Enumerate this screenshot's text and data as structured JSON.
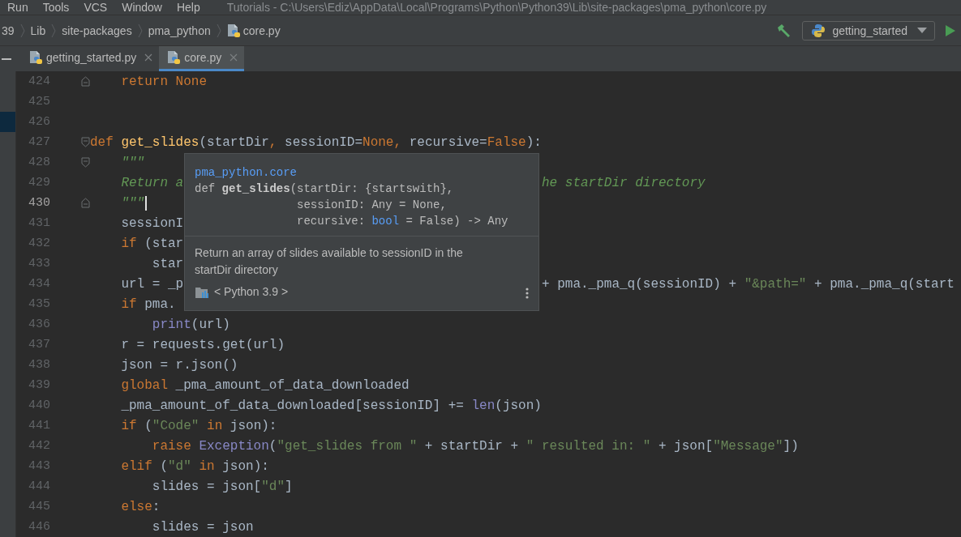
{
  "menu": [
    {
      "label": "Run"
    },
    {
      "label": "Tools"
    },
    {
      "label": "VCS"
    },
    {
      "label": "Window"
    },
    {
      "label": "Help"
    }
  ],
  "window_title": "Tutorials - C:\\Users\\Ediz\\AppData\\Local\\Programs\\Python\\Python39\\Lib\\site-packages\\pma_python\\core.py",
  "breadcrumbs": [
    {
      "label": "39",
      "kind": "folder"
    },
    {
      "label": "Lib",
      "kind": "folder"
    },
    {
      "label": "site-packages",
      "kind": "folder"
    },
    {
      "label": "pma_python",
      "kind": "folder"
    },
    {
      "label": "core.py",
      "kind": "file"
    }
  ],
  "run_config": {
    "label": "getting_started"
  },
  "tabs": [
    {
      "label": "getting_started.py",
      "selected": false
    },
    {
      "label": "core.py",
      "selected": true
    }
  ],
  "code": [
    {
      "kind": "context",
      "children": [
        {
          "number": "424",
          "fold": {
            "kind": "end"
          },
          "tokens": [
            {
              "text": "return None",
              "kind": "kw"
            }
          ]
        }
      ]
    },
    {
      "kind": "line",
      "number": "425"
    },
    {
      "kind": "line",
      "number": "426"
    },
    {
      "kind": "line",
      "number": "427",
      "fold": {
        "kind": "start"
      },
      "tokens": [
        {
          "text": "def ",
          "kind": "kw"
        },
        {
          "text": "get_slides",
          "kind": "fn"
        },
        {
          "text": "(startDir",
          "kind": "plain"
        },
        {
          "text": ", ",
          "kind": "kw"
        },
        {
          "text": "sessionID=",
          "kind": "plain"
        },
        {
          "text": "None",
          "kind": "kw"
        },
        {
          "text": ", ",
          "kind": "kw"
        },
        {
          "text": "recursive=",
          "kind": "plain"
        },
        {
          "text": "False",
          "kind": "kw"
        },
        {
          "text": "):",
          "kind": "plain"
        }
      ],
      "children": [
        {
          "number": "428",
          "fold": {
            "kind": "start"
          },
          "tokens": [
            {
              "text": "\"\"\"",
              "kind": "doc"
            }
          ]
        },
        {
          "number": "429",
          "tokens": [
            {
              "text": "Return a",
              "kind": "doc"
            }
          ],
          "tail": [
            {
              "text": "he startDir directory",
              "kind": "doc"
            }
          ]
        },
        {
          "number": "430",
          "fold": {
            "kind": "end"
          },
          "current": true,
          "caret": true,
          "tokens": [
            {
              "text": "\"\"\"",
              "kind": "doc"
            }
          ]
        },
        {
          "number": "431",
          "tokens": [
            {
              "text": "sessionI",
              "kind": "plain"
            }
          ]
        },
        {
          "number": "432",
          "tokens": [
            {
              "text": "if ",
              "kind": "kw"
            },
            {
              "text": "(star",
              "kind": "plain"
            }
          ],
          "children": [
            {
              "number": "433",
              "tokens": [
                {
                  "text": "star",
                  "kind": "plain"
                }
              ]
            }
          ]
        },
        {
          "number": "434",
          "tokens": [
            {
              "text": "url = _p",
              "kind": "plain"
            }
          ],
          "tail": [
            {
              "text": "+ pma._pma_q(sessionID) + ",
              "kind": "plain"
            },
            {
              "text": "\"&path=\"",
              "kind": "str"
            },
            {
              "text": " + pma._pma_q(start",
              "kind": "plain"
            }
          ]
        },
        {
          "number": "435",
          "tokens": [
            {
              "text": "if ",
              "kind": "kw"
            },
            {
              "text": "pma.",
              "kind": "plain"
            }
          ],
          "children": [
            {
              "number": "436",
              "tokens": [
                {
                  "text": "print",
                  "kind": "builtin"
                },
                {
                  "text": "(url)",
                  "kind": "plain"
                }
              ]
            }
          ]
        },
        {
          "number": "437",
          "tokens": [
            {
              "text": "r = requests.get(url)",
              "kind": "plain"
            }
          ]
        },
        {
          "number": "438",
          "tokens": [
            {
              "text": "json = r.json()",
              "kind": "plain"
            }
          ]
        },
        {
          "number": "439",
          "tokens": [
            {
              "text": "global ",
              "kind": "kw"
            },
            {
              "text": "_pma_amount_of_data_downloaded",
              "kind": "plain"
            }
          ]
        },
        {
          "number": "440",
          "tokens": [
            {
              "text": "_pma_amount_of_data_downloaded[sessionID] += ",
              "kind": "plain"
            },
            {
              "text": "len",
              "kind": "builtin"
            },
            {
              "text": "(json)",
              "kind": "plain"
            }
          ]
        },
        {
          "number": "441",
          "tokens": [
            {
              "text": "if ",
              "kind": "kw"
            },
            {
              "text": "(",
              "kind": "plain"
            },
            {
              "text": "\"Code\"",
              "kind": "str"
            },
            {
              "text": " in ",
              "kind": "kw"
            },
            {
              "text": "json):",
              "kind": "plain"
            }
          ],
          "children": [
            {
              "number": "442",
              "tokens": [
                {
                  "text": "raise ",
                  "kind": "kw"
                },
                {
                  "text": "Exception",
                  "kind": "builtin"
                },
                {
                  "text": "(",
                  "kind": "plain"
                },
                {
                  "text": "\"get_slides from \"",
                  "kind": "str"
                },
                {
                  "text": " + startDir + ",
                  "kind": "plain"
                },
                {
                  "text": "\" resulted in: \"",
                  "kind": "str"
                },
                {
                  "text": " + json[",
                  "kind": "plain"
                },
                {
                  "text": "\"Message\"",
                  "kind": "str"
                },
                {
                  "text": "])",
                  "kind": "plain"
                }
              ]
            }
          ]
        },
        {
          "number": "443",
          "tokens": [
            {
              "text": "elif ",
              "kind": "kw"
            },
            {
              "text": "(",
              "kind": "plain"
            },
            {
              "text": "\"d\"",
              "kind": "str"
            },
            {
              "text": " in ",
              "kind": "kw"
            },
            {
              "text": "json):",
              "kind": "plain"
            }
          ],
          "children": [
            {
              "number": "444",
              "tokens": [
                {
                  "text": "slides = json[",
                  "kind": "plain"
                },
                {
                  "text": "\"d\"",
                  "kind": "str"
                },
                {
                  "text": "]",
                  "kind": "plain"
                }
              ]
            }
          ]
        },
        {
          "number": "445",
          "tokens": [
            {
              "text": "else",
              "kind": "kw"
            },
            {
              "text": ":",
              "kind": "plain"
            }
          ],
          "children": [
            {
              "number": "446",
              "tokens": [
                {
                  "text": "slides = json",
                  "kind": "plain"
                }
              ]
            }
          ]
        }
      ]
    }
  ],
  "quick_doc": {
    "module": "pma_python.core",
    "signature": {
      "prefix": [
        {
          "text": "def ",
          "kind": "plain"
        },
        {
          "text": "get_slides",
          "kind": "bold"
        },
        {
          "text": "(",
          "kind": "plain"
        }
      ],
      "params": [
        [
          {
            "text": "startDir: {startswith},",
            "kind": "plain"
          }
        ],
        [
          {
            "text": "sessionID: Any = None,",
            "kind": "plain"
          }
        ],
        [
          {
            "text": "recursive: ",
            "kind": "plain"
          },
          {
            "text": "bool",
            "kind": "type"
          },
          {
            "text": " = False) -> Any",
            "kind": "plain"
          }
        ]
      ]
    },
    "description": "Return an array of slides available to sessionID in the startDir directory",
    "sdk": "< Python 3.9 >"
  }
}
